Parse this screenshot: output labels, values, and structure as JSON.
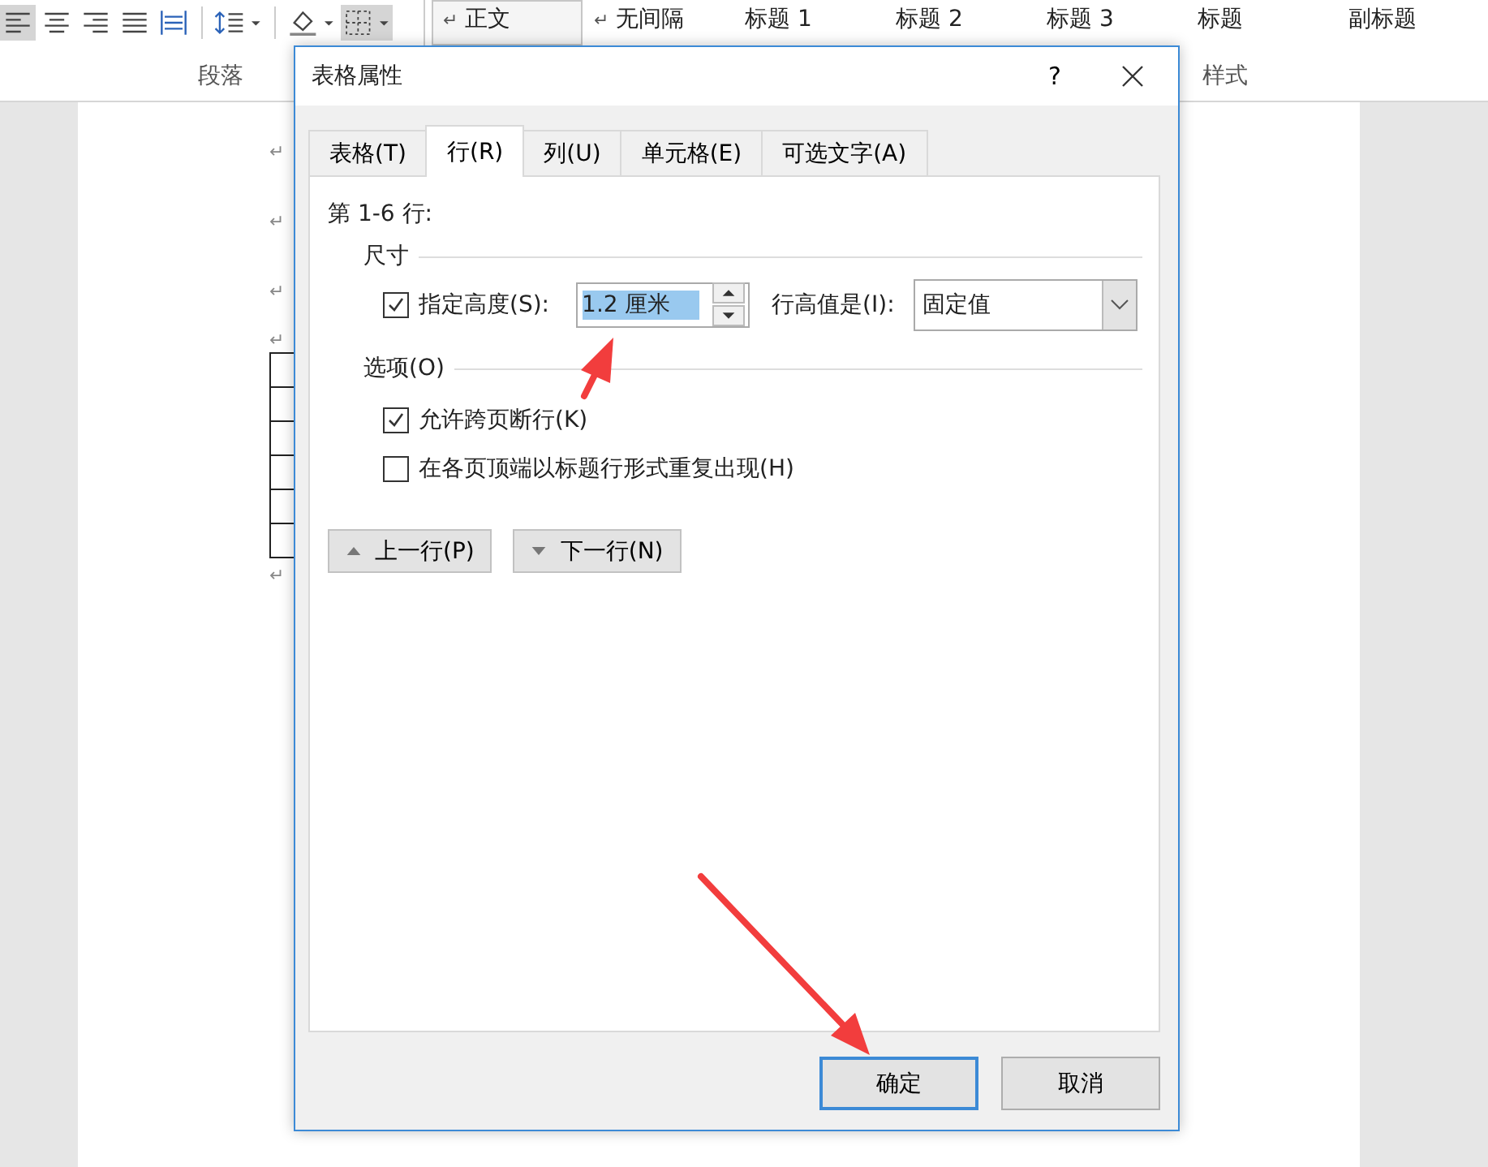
{
  "ribbon": {
    "styles": [
      {
        "mark": "↵",
        "label": "正文",
        "selected": true
      },
      {
        "mark": "↵",
        "label": "无间隔",
        "selected": false
      },
      {
        "label": "标题 1",
        "selected": false
      },
      {
        "label": "标题 2",
        "selected": false
      },
      {
        "label": "标题 3",
        "selected": false
      },
      {
        "label": "标题",
        "selected": false
      },
      {
        "label": "副标题",
        "selected": false
      }
    ],
    "groups": [
      "段落",
      "样式"
    ]
  },
  "document": {
    "paragraph_marks": [
      "↵",
      "↵",
      "↵",
      "↵"
    ],
    "end_mark": "↵"
  },
  "dialog": {
    "title": "表格属性",
    "help": "?",
    "tabs": [
      {
        "label": "表格(T)",
        "selected": false
      },
      {
        "label": "行(R)",
        "selected": true
      },
      {
        "label": "列(U)",
        "selected": false
      },
      {
        "label": "单元格(E)",
        "selected": false
      },
      {
        "label": "可选文字(A)",
        "selected": false
      }
    ],
    "heading": "第 1-6 行:",
    "size": {
      "title": "尺寸",
      "specify_height": {
        "label": "指定高度(S):",
        "checked": true
      },
      "height": {
        "value": "1.2 厘米"
      },
      "rule_label": "行高值是(I):",
      "rule": {
        "value": "固定值"
      }
    },
    "options": {
      "title": "选项(O)",
      "items": [
        {
          "label": "允许跨页断行(K)",
          "checked": true
        },
        {
          "label": "在各页顶端以标题行形式重复出现(H)",
          "checked": false
        }
      ]
    },
    "nav_buttons": [
      {
        "label": "上一行(P)",
        "kind": "up"
      },
      {
        "label": "下一行(N)",
        "kind": "down"
      }
    ],
    "buttons": [
      {
        "label": "确定",
        "default": true
      },
      {
        "label": "取消",
        "default": false
      }
    ]
  }
}
